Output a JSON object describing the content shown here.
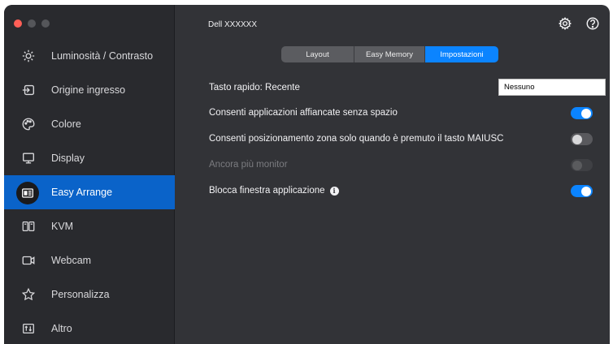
{
  "window": {
    "title": "Dell XXXXXX"
  },
  "sidebar": {
    "items": [
      {
        "label": "Luminosità / Contrasto",
        "icon": "brightness-icon",
        "active": false
      },
      {
        "label": "Origine ingresso",
        "icon": "input-source-icon",
        "active": false
      },
      {
        "label": "Colore",
        "icon": "color-palette-icon",
        "active": false
      },
      {
        "label": "Display",
        "icon": "monitor-icon",
        "active": false
      },
      {
        "label": "Easy Arrange",
        "icon": "easy-arrange-icon",
        "active": true
      },
      {
        "label": "KVM",
        "icon": "kvm-icon",
        "active": false
      },
      {
        "label": "Webcam",
        "icon": "webcam-icon",
        "active": false
      },
      {
        "label": "Personalizza",
        "icon": "star-icon",
        "active": false
      },
      {
        "label": "Altro",
        "icon": "other-icon",
        "active": false
      }
    ]
  },
  "tabs": [
    {
      "label": "Layout",
      "selected": false
    },
    {
      "label": "Easy Memory",
      "selected": false
    },
    {
      "label": "Impostazioni",
      "selected": true
    }
  ],
  "settings": {
    "hotkey_label": "Tasto rapido: Recente",
    "hotkey_value": "Nessuno",
    "rows": [
      {
        "label": "Consenti applicazioni affiancate senza spazio",
        "state": "on"
      },
      {
        "label": "Consenti posizionamento zona solo quando è premuto il tasto MAIUSC",
        "state": "off"
      },
      {
        "label": "Ancora più monitor",
        "state": "disabled"
      },
      {
        "label": "Blocca finestra applicazione",
        "state": "on",
        "info": true
      }
    ]
  },
  "colors": {
    "accent": "#0b84ff",
    "sidebar_active": "#0a63c9",
    "background": "#323337",
    "sidebar": "#292a2e"
  },
  "top_icons": [
    "settings-gear-icon",
    "help-icon"
  ]
}
